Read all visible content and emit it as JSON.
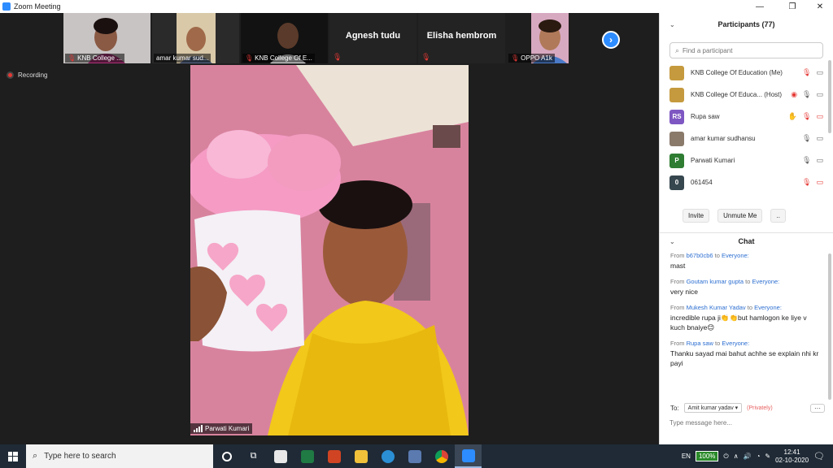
{
  "window": {
    "title": "Zoom Meeting"
  },
  "video_strip": [
    {
      "label": "KNB College ...",
      "kind": "video",
      "muted": true
    },
    {
      "label": "amar kumar sud...",
      "kind": "video",
      "muted": false
    },
    {
      "label": "KNB College Of E...",
      "kind": "video",
      "muted": true
    },
    {
      "label": "Agnesh tudu",
      "kind": "name",
      "muted": true
    },
    {
      "label": "Elisha hembrom",
      "kind": "name",
      "muted": true
    },
    {
      "label": "OPPO A1k",
      "kind": "video",
      "muted": true
    }
  ],
  "recording": {
    "label": "Recording"
  },
  "active_speaker": {
    "name": "Parwati Kumari"
  },
  "participants": {
    "title": "Participants (77)",
    "search_placeholder": "Find a participant",
    "list": [
      {
        "name": "KNB College Of Education (Me)",
        "avatar": "",
        "avatar_color": "#c59a3e",
        "icons": [
          "mic-muted-icon",
          "video-icon"
        ]
      },
      {
        "name": "KNB College Of Educa... (Host)",
        "avatar": "",
        "avatar_color": "#c59a3e",
        "icons": [
          "record-icon",
          "mic-icon",
          "video-icon"
        ]
      },
      {
        "name": "Rupa saw",
        "avatar": "RS",
        "avatar_color": "#7e57c2",
        "icons": [
          "raise-hand-icon",
          "mic-muted-icon",
          "video-off-icon"
        ]
      },
      {
        "name": "amar kumar sudhansu",
        "avatar": "",
        "avatar_color": "#8a7a6a",
        "icons": [
          "mic-icon",
          "video-icon"
        ]
      },
      {
        "name": "Parwati Kumari",
        "avatar": "P",
        "avatar_color": "#2e7d32",
        "icons": [
          "mic-active-icon",
          "video-icon"
        ]
      },
      {
        "name": "061454",
        "avatar": "0",
        "avatar_color": "#37474f",
        "icons": [
          "mic-muted-icon",
          "video-off-icon"
        ]
      }
    ],
    "buttons": {
      "invite": "Invite",
      "unmute": "Unmute Me",
      "more": ".."
    }
  },
  "chat": {
    "title": "Chat",
    "messages": [
      {
        "from_label": "From",
        "sender": "b67b0cb6",
        "to_label": "to",
        "recipient": "Everyone:",
        "text": "mast"
      },
      {
        "from_label": "From",
        "sender": "Goutam kumar gupta",
        "to_label": "to",
        "recipient": "Everyone:",
        "text": "very nice"
      },
      {
        "from_label": "From",
        "sender": "Mukesh Kumar Yadav",
        "to_label": "to",
        "recipient": "Everyone:",
        "text": "incredible rupa ji👏👏but hamlogon ke liye v kuch bnaiye😊"
      },
      {
        "from_label": "From",
        "sender": "Rupa saw",
        "to_label": "to",
        "recipient": "Everyone:",
        "text": "Thanku sayad mai bahut achhe se explain nhi kr payi"
      }
    ],
    "to_label": "To:",
    "to_value": "Amit kumar yadav ▾",
    "privately": "(Privately)",
    "more": "···",
    "input_placeholder": "Type message here..."
  },
  "taskbar": {
    "search_placeholder": "Type here to search",
    "language": "EN",
    "battery": "100%",
    "time": "12:41",
    "date": "02-10-2020"
  }
}
